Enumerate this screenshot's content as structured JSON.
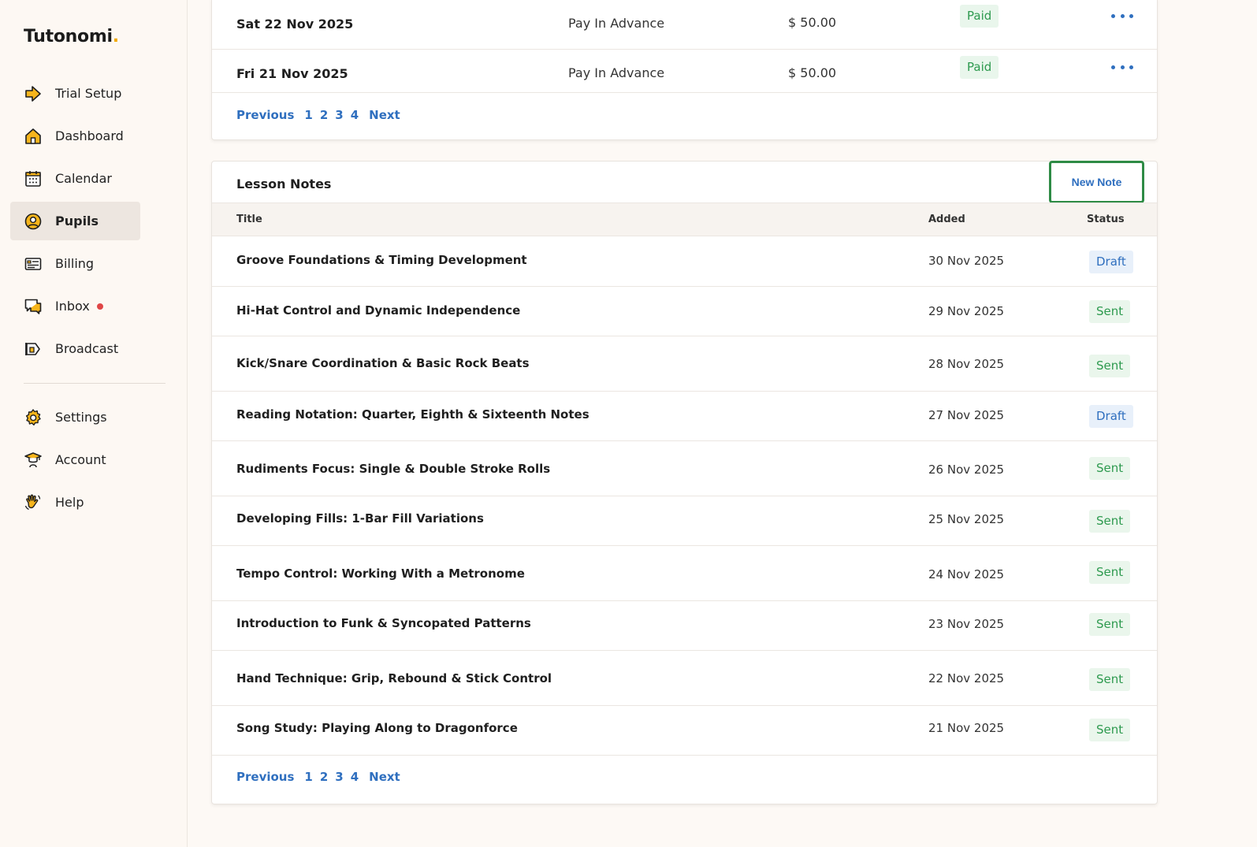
{
  "brand": {
    "name": "Tutonomi",
    "dot": "."
  },
  "sidebar": {
    "items": [
      {
        "label": "Trial Setup",
        "icon": "arrow-right-icon"
      },
      {
        "label": "Dashboard",
        "icon": "home-icon"
      },
      {
        "label": "Calendar",
        "icon": "calendar-icon"
      },
      {
        "label": "Pupils",
        "icon": "user-circle-icon",
        "active": true
      },
      {
        "label": "Billing",
        "icon": "billing-icon"
      },
      {
        "label": "Inbox",
        "icon": "chat-icon",
        "unread": true
      },
      {
        "label": "Broadcast",
        "icon": "megaphone-icon"
      },
      {
        "label": "Settings",
        "icon": "gear-icon"
      },
      {
        "label": "Account",
        "icon": "graduation-cap-icon"
      },
      {
        "label": "Help",
        "icon": "hand-wave-icon"
      }
    ]
  },
  "payments": {
    "rows": [
      {
        "date": "Sat 22 Nov 2025",
        "type": "Pay In Advance",
        "amount": "$ 50.00",
        "status": "Paid"
      },
      {
        "date": "Fri 21 Nov 2025",
        "type": "Pay In Advance",
        "amount": "$ 50.00",
        "status": "Paid"
      }
    ],
    "pager": {
      "previous": "Previous",
      "pages": [
        "1",
        "2",
        "3",
        "4"
      ],
      "next": "Next"
    }
  },
  "notes": {
    "title": "Lesson Notes",
    "new_button": "New Note",
    "columns": {
      "title": "Title",
      "added": "Added",
      "status": "Status"
    },
    "rows": [
      {
        "title": "Groove Foundations & Timing Development",
        "added": "30 Nov 2025",
        "status": "Draft"
      },
      {
        "title": "Hi-Hat Control and Dynamic Independence",
        "added": "29 Nov 2025",
        "status": "Sent"
      },
      {
        "title": "Kick/Snare Coordination & Basic Rock Beats",
        "added": "28 Nov 2025",
        "status": "Sent"
      },
      {
        "title": "Reading Notation: Quarter, Eighth & Sixteenth Notes",
        "added": "27 Nov 2025",
        "status": "Draft"
      },
      {
        "title": "Rudiments Focus: Single & Double Stroke Rolls",
        "added": "26 Nov 2025",
        "status": "Sent"
      },
      {
        "title": "Developing Fills: 1-Bar Fill Variations",
        "added": "25 Nov 2025",
        "status": "Sent"
      },
      {
        "title": "Tempo Control: Working With a Metronome",
        "added": "24 Nov 2025",
        "status": "Sent"
      },
      {
        "title": "Introduction to Funk & Syncopated Patterns",
        "added": "23 Nov 2025",
        "status": "Sent"
      },
      {
        "title": "Hand Technique: Grip, Rebound & Stick Control",
        "added": "22 Nov 2025",
        "status": "Sent"
      },
      {
        "title": "Song Study: Playing Along to Dragonforce",
        "added": "21 Nov 2025",
        "status": "Sent"
      }
    ],
    "pager": {
      "previous": "Previous",
      "pages": [
        "1",
        "2",
        "3",
        "4"
      ],
      "next": "Next"
    }
  },
  "colors": {
    "accent": "#2f6fbf",
    "sent": "#2e9a4f",
    "draft": "#2f6fbf",
    "highlight_border": "#2e8b45",
    "brand_dot": "#f2a900",
    "inbox_dot": "#e04646"
  }
}
